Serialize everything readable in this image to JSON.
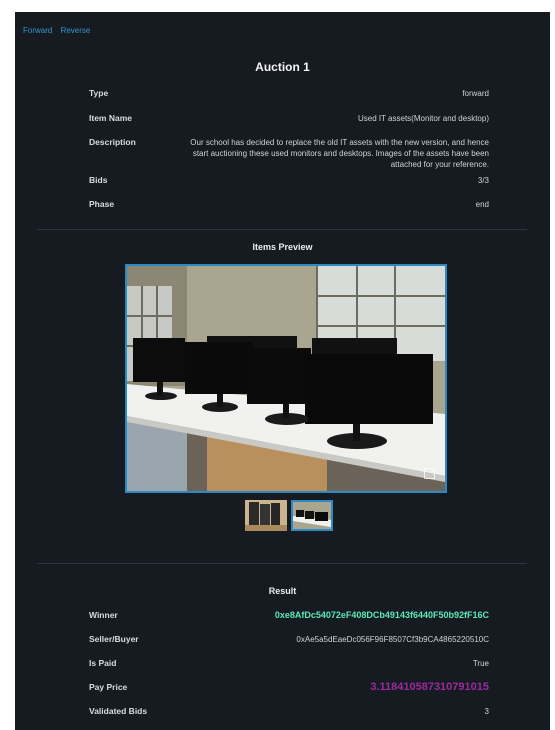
{
  "nav": {
    "forward": "Forward",
    "reverse": "Reverse"
  },
  "auction": {
    "title": "Auction 1",
    "rows": [
      {
        "label": "Type",
        "value": "forward"
      },
      {
        "label": "Item Name",
        "value": "Used IT assets(Monitor and desktop)"
      },
      {
        "label": "Description",
        "value": "Our school has decided to replace the old IT assets with the new version, and hence start auctioning these used monitors and desktops. Images of the assets have been attached for your reference."
      },
      {
        "label": "Bids",
        "value": "3/3"
      },
      {
        "label": "Phase",
        "value": "end"
      }
    ]
  },
  "preview": {
    "title": "Items Preview",
    "thumbnail_count": 2,
    "selected_thumbnail": 2
  },
  "result": {
    "title": "Result",
    "rows": [
      {
        "label": "Winner",
        "value": "0xe8AfDc54072eF408DCb49143f6440F50b92fF16C"
      },
      {
        "label": "Seller/Buyer",
        "value": "0xAe5a5dEaeDc056F96F8507Cf3b9CA4865220510C"
      },
      {
        "label": "Is Paid",
        "value": "True"
      },
      {
        "label": "Pay Price",
        "value": "3.118410587310791015"
      },
      {
        "label": "Validated Bids",
        "value": "3"
      }
    ]
  },
  "colors": {
    "background": "#161b21",
    "link": "#3b93c9",
    "winner": "#5ce9b7",
    "price": "#9a2aa0",
    "accent_border": "#2a8ac4"
  }
}
